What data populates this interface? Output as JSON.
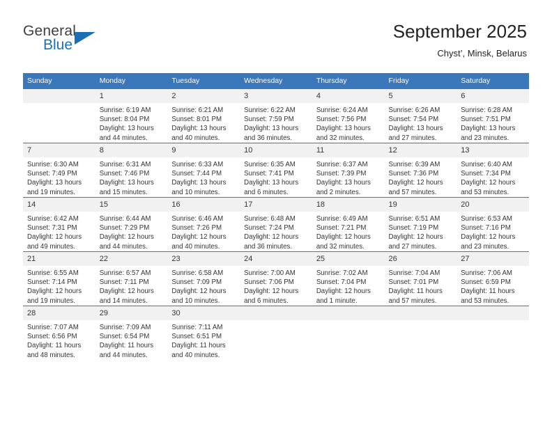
{
  "brand": {
    "name_part1": "General",
    "name_part2": "Blue",
    "color_primary": "#1a6fb5",
    "color_text": "#3f3f3f"
  },
  "header": {
    "title": "September 2025",
    "subtitle": "Chyst’, Minsk, Belarus"
  },
  "theme": {
    "header_blue": "#3b77bb",
    "daynum_band": "#f1f1f1",
    "text": "#333333"
  },
  "calendar": {
    "weekday_headers": [
      "Sunday",
      "Monday",
      "Tuesday",
      "Wednesday",
      "Thursday",
      "Friday",
      "Saturday"
    ],
    "weeks": [
      [
        {
          "day": "",
          "sunrise": "",
          "sunset": "",
          "daylight": "",
          "empty": true
        },
        {
          "day": "1",
          "sunrise": "Sunrise: 6:19 AM",
          "sunset": "Sunset: 8:04 PM",
          "daylight": "Daylight: 13 hours and 44 minutes."
        },
        {
          "day": "2",
          "sunrise": "Sunrise: 6:21 AM",
          "sunset": "Sunset: 8:01 PM",
          "daylight": "Daylight: 13 hours and 40 minutes."
        },
        {
          "day": "3",
          "sunrise": "Sunrise: 6:22 AM",
          "sunset": "Sunset: 7:59 PM",
          "daylight": "Daylight: 13 hours and 36 minutes."
        },
        {
          "day": "4",
          "sunrise": "Sunrise: 6:24 AM",
          "sunset": "Sunset: 7:56 PM",
          "daylight": "Daylight: 13 hours and 32 minutes."
        },
        {
          "day": "5",
          "sunrise": "Sunrise: 6:26 AM",
          "sunset": "Sunset: 7:54 PM",
          "daylight": "Daylight: 13 hours and 27 minutes."
        },
        {
          "day": "6",
          "sunrise": "Sunrise: 6:28 AM",
          "sunset": "Sunset: 7:51 PM",
          "daylight": "Daylight: 13 hours and 23 minutes."
        }
      ],
      [
        {
          "day": "7",
          "sunrise": "Sunrise: 6:30 AM",
          "sunset": "Sunset: 7:49 PM",
          "daylight": "Daylight: 13 hours and 19 minutes."
        },
        {
          "day": "8",
          "sunrise": "Sunrise: 6:31 AM",
          "sunset": "Sunset: 7:46 PM",
          "daylight": "Daylight: 13 hours and 15 minutes."
        },
        {
          "day": "9",
          "sunrise": "Sunrise: 6:33 AM",
          "sunset": "Sunset: 7:44 PM",
          "daylight": "Daylight: 13 hours and 10 minutes."
        },
        {
          "day": "10",
          "sunrise": "Sunrise: 6:35 AM",
          "sunset": "Sunset: 7:41 PM",
          "daylight": "Daylight: 13 hours and 6 minutes."
        },
        {
          "day": "11",
          "sunrise": "Sunrise: 6:37 AM",
          "sunset": "Sunset: 7:39 PM",
          "daylight": "Daylight: 13 hours and 2 minutes."
        },
        {
          "day": "12",
          "sunrise": "Sunrise: 6:39 AM",
          "sunset": "Sunset: 7:36 PM",
          "daylight": "Daylight: 12 hours and 57 minutes."
        },
        {
          "day": "13",
          "sunrise": "Sunrise: 6:40 AM",
          "sunset": "Sunset: 7:34 PM",
          "daylight": "Daylight: 12 hours and 53 minutes."
        }
      ],
      [
        {
          "day": "14",
          "sunrise": "Sunrise: 6:42 AM",
          "sunset": "Sunset: 7:31 PM",
          "daylight": "Daylight: 12 hours and 49 minutes."
        },
        {
          "day": "15",
          "sunrise": "Sunrise: 6:44 AM",
          "sunset": "Sunset: 7:29 PM",
          "daylight": "Daylight: 12 hours and 44 minutes."
        },
        {
          "day": "16",
          "sunrise": "Sunrise: 6:46 AM",
          "sunset": "Sunset: 7:26 PM",
          "daylight": "Daylight: 12 hours and 40 minutes."
        },
        {
          "day": "17",
          "sunrise": "Sunrise: 6:48 AM",
          "sunset": "Sunset: 7:24 PM",
          "daylight": "Daylight: 12 hours and 36 minutes."
        },
        {
          "day": "18",
          "sunrise": "Sunrise: 6:49 AM",
          "sunset": "Sunset: 7:21 PM",
          "daylight": "Daylight: 12 hours and 32 minutes."
        },
        {
          "day": "19",
          "sunrise": "Sunrise: 6:51 AM",
          "sunset": "Sunset: 7:19 PM",
          "daylight": "Daylight: 12 hours and 27 minutes."
        },
        {
          "day": "20",
          "sunrise": "Sunrise: 6:53 AM",
          "sunset": "Sunset: 7:16 PM",
          "daylight": "Daylight: 12 hours and 23 minutes."
        }
      ],
      [
        {
          "day": "21",
          "sunrise": "Sunrise: 6:55 AM",
          "sunset": "Sunset: 7:14 PM",
          "daylight": "Daylight: 12 hours and 19 minutes."
        },
        {
          "day": "22",
          "sunrise": "Sunrise: 6:57 AM",
          "sunset": "Sunset: 7:11 PM",
          "daylight": "Daylight: 12 hours and 14 minutes."
        },
        {
          "day": "23",
          "sunrise": "Sunrise: 6:58 AM",
          "sunset": "Sunset: 7:09 PM",
          "daylight": "Daylight: 12 hours and 10 minutes."
        },
        {
          "day": "24",
          "sunrise": "Sunrise: 7:00 AM",
          "sunset": "Sunset: 7:06 PM",
          "daylight": "Daylight: 12 hours and 6 minutes."
        },
        {
          "day": "25",
          "sunrise": "Sunrise: 7:02 AM",
          "sunset": "Sunset: 7:04 PM",
          "daylight": "Daylight: 12 hours and 1 minute."
        },
        {
          "day": "26",
          "sunrise": "Sunrise: 7:04 AM",
          "sunset": "Sunset: 7:01 PM",
          "daylight": "Daylight: 11 hours and 57 minutes."
        },
        {
          "day": "27",
          "sunrise": "Sunrise: 7:06 AM",
          "sunset": "Sunset: 6:59 PM",
          "daylight": "Daylight: 11 hours and 53 minutes."
        }
      ],
      [
        {
          "day": "28",
          "sunrise": "Sunrise: 7:07 AM",
          "sunset": "Sunset: 6:56 PM",
          "daylight": "Daylight: 11 hours and 48 minutes."
        },
        {
          "day": "29",
          "sunrise": "Sunrise: 7:09 AM",
          "sunset": "Sunset: 6:54 PM",
          "daylight": "Daylight: 11 hours and 44 minutes."
        },
        {
          "day": "30",
          "sunrise": "Sunrise: 7:11 AM",
          "sunset": "Sunset: 6:51 PM",
          "daylight": "Daylight: 11 hours and 40 minutes."
        },
        {
          "day": "",
          "sunrise": "",
          "sunset": "",
          "daylight": "",
          "empty": true
        },
        {
          "day": "",
          "sunrise": "",
          "sunset": "",
          "daylight": "",
          "empty": true
        },
        {
          "day": "",
          "sunrise": "",
          "sunset": "",
          "daylight": "",
          "empty": true
        },
        {
          "day": "",
          "sunrise": "",
          "sunset": "",
          "daylight": "",
          "empty": true
        }
      ]
    ]
  }
}
